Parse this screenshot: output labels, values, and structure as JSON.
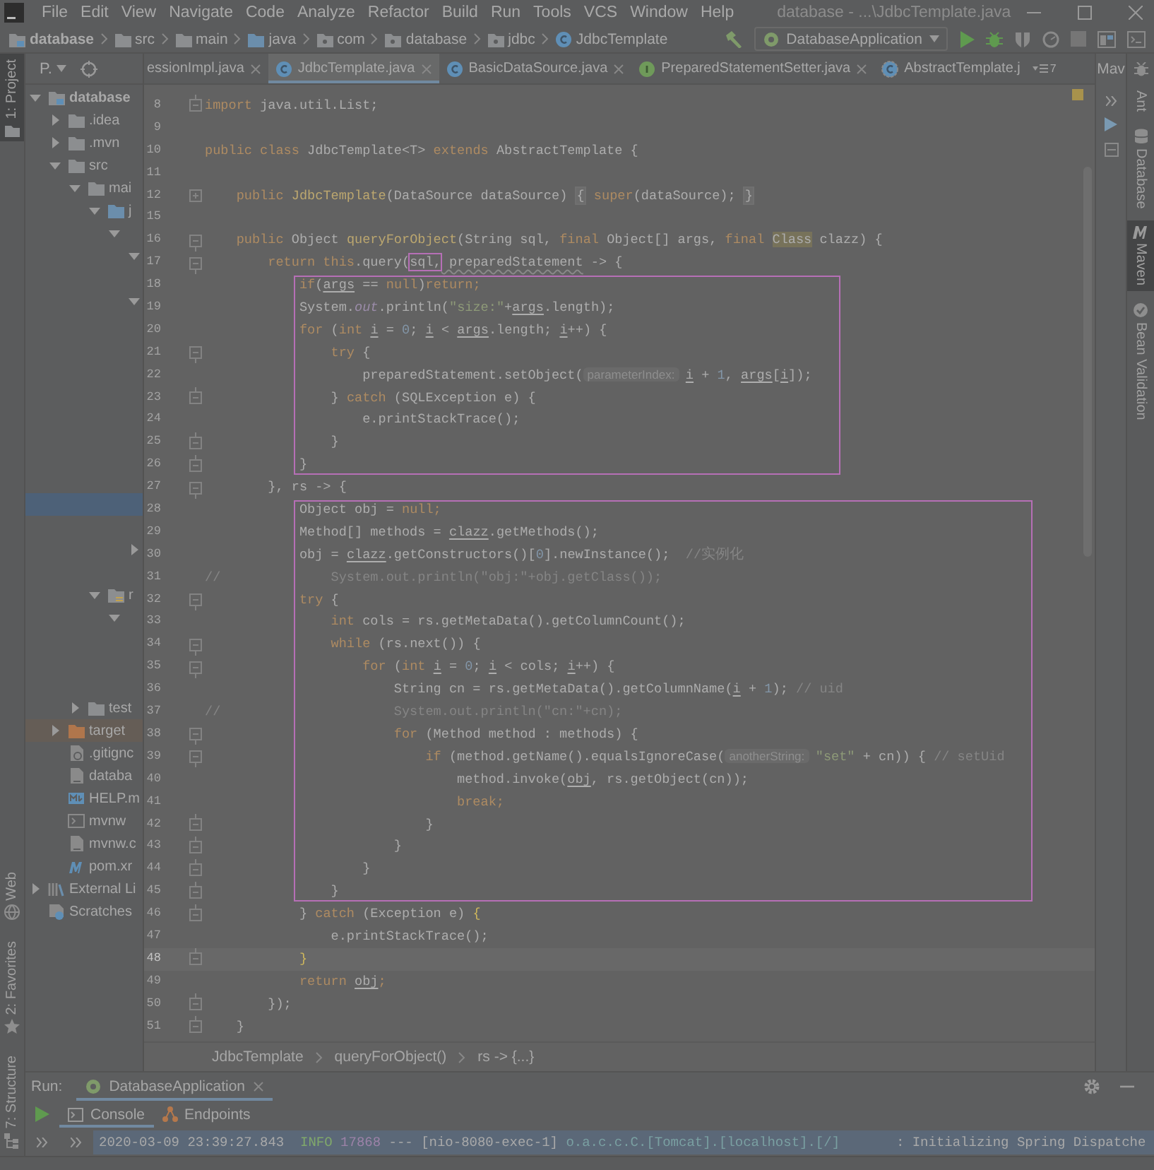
{
  "menu_bar": {
    "items": [
      "File",
      "Edit",
      "View",
      "Navigate",
      "Code",
      "Analyze",
      "Refactor",
      "Build",
      "Run",
      "Tools",
      "VCS",
      "Window",
      "Help"
    ],
    "title": "database - ...\\JdbcTemplate.java"
  },
  "navigation_bar": {
    "breadcrumbs": [
      {
        "label": "database",
        "kind": "module"
      },
      {
        "label": "src",
        "kind": "folder"
      },
      {
        "label": "main",
        "kind": "folder"
      },
      {
        "label": "java",
        "kind": "source"
      },
      {
        "label": "com",
        "kind": "package"
      },
      {
        "label": "database",
        "kind": "package"
      },
      {
        "label": "jdbc",
        "kind": "package"
      },
      {
        "label": "JdbcTemplate",
        "kind": "class"
      }
    ],
    "run_configuration": "DatabaseApplication"
  },
  "left_tool_strip": [
    {
      "label": "1: Project",
      "kind": "project",
      "selected": true
    },
    {
      "label": "Web",
      "kind": "web",
      "selected": false
    },
    {
      "label": "2: Favorites",
      "kind": "favorites",
      "selected": false
    },
    {
      "label": "7: Structure",
      "kind": "structure",
      "selected": false
    }
  ],
  "project_panel": {
    "view": "P.",
    "tree": [
      {
        "label": "database",
        "kind": "module",
        "expanded": true,
        "selected": false,
        "children": [
          {
            "label": ".idea",
            "kind": "folder",
            "expanded": false,
            "selected": false
          },
          {
            "label": ".mvn",
            "kind": "folder",
            "expanded": false,
            "selected": false
          },
          {
            "label": "src",
            "kind": "folder",
            "expanded": true,
            "selected": false,
            "children": [
              {
                "label": "mai",
                "kind": "folder",
                "expanded": true,
                "selected": false,
                "children": [
                  {
                    "label": "j",
                    "kind": "source",
                    "expanded": true,
                    "selected": false,
                    "children": [
                      {
                        "expanded": true,
                        "selected": false,
                        "children": [
                          {
                            "expanded": true,
                            "selected": false,
                            "children": [
                              {
                                "selected": false
                              }
                            ]
                          },
                          {
                            "expanded": true,
                            "selected": false,
                            "children": [
                              {
                                "selected": false
                              },
                              {
                                "selected": false
                              },
                              {
                                "selected": false
                              },
                              {
                                "selected": false
                              },
                              {
                                "selected": false
                              },
                              {
                                "selected": false
                              },
                              {
                                "selected": false
                              },
                              {
                                "selected": false
                              },
                              {
                                "selected": true
                              },
                              {
                                "selected": false
                              }
                            ]
                          },
                          {
                            "expanded": false,
                            "selected": false
                          },
                          {
                            "selected": false
                          }
                        ]
                      }
                    ]
                  },
                  {
                    "label": "r",
                    "kind": "resources",
                    "expanded": true,
                    "selected": false,
                    "children": [
                      {
                        "expanded": true,
                        "selected": false,
                        "children": [
                          {
                            "selected": false
                          },
                          {
                            "selected": false
                          },
                          {
                            "selected": false
                          }
                        ]
                      }
                    ]
                  }
                ]
              },
              {
                "label": "test",
                "kind": "folder",
                "expanded": false,
                "selected": false
              }
            ]
          },
          {
            "label": "target",
            "kind": "excluded",
            "expanded": false,
            "selected": false
          },
          {
            "label": ".gitignc",
            "kind": "ignore-file",
            "selected": false
          },
          {
            "label": "databa",
            "kind": "file",
            "selected": false
          },
          {
            "label": "HELP.m",
            "kind": "markdown",
            "selected": false
          },
          {
            "label": "mvnw",
            "kind": "script",
            "selected": false
          },
          {
            "label": "mvnw.c",
            "kind": "file",
            "selected": false
          },
          {
            "label": "pom.xr",
            "kind": "maven-pom",
            "selected": false
          }
        ]
      },
      {
        "label": "External Li",
        "kind": "library",
        "expanded": false,
        "selected": false
      },
      {
        "label": "Scratches",
        "kind": "scratch",
        "selected": false
      }
    ]
  },
  "editor": {
    "tabs": [
      {
        "label": "essionImpl.java",
        "kind": "hidden",
        "selected": false,
        "closable": true
      },
      {
        "label": "JdbcTemplate.java",
        "kind": "class",
        "selected": true,
        "closable": true
      },
      {
        "label": "BasicDataSource.java",
        "kind": "class",
        "selected": false,
        "closable": true
      },
      {
        "label": "PreparedStatementSetter.java",
        "kind": "interface",
        "selected": false,
        "closable": true
      },
      {
        "label": "AbstractTemplate.j",
        "kind": "abstract",
        "selected": false,
        "closable": false
      }
    ],
    "overflow_count": "7",
    "blocks": [
      {
        "boxed": false,
        "lines": [
          {
            "number": "8",
            "kind": "fold-end",
            "current": false,
            "tokens": [
              {
                "kind": "kw",
                "text": "import"
              },
              {
                "kind": "plain",
                "text": " java.util.List;"
              }
            ]
          },
          {
            "number": "9",
            "kind": "plain",
            "current": false
          },
          {
            "number": "10",
            "kind": "plain",
            "current": false,
            "tokens": [
              {
                "kind": "kw",
                "text": "public class "
              },
              {
                "kind": "plain",
                "text": "JdbcTemplate<T> "
              },
              {
                "kind": "kw",
                "text": "extends "
              },
              {
                "kind": "plain",
                "text": "AbstractTemplate {"
              }
            ]
          },
          {
            "number": "11",
            "kind": "plain",
            "current": false
          },
          {
            "number": "12",
            "kind": "folded",
            "current": false,
            "tokens": [
              {
                "kind": "kw",
                "text": "    public "
              },
              {
                "kind": "decl",
                "text": "JdbcTemplate"
              },
              {
                "kind": "plain",
                "text": "(DataSource dataSource) "
              },
              {
                "kind": "folded",
                "text": "{"
              },
              {
                "kind": "kw",
                "text": " super"
              },
              {
                "kind": "plain",
                "text": "(dataSource); "
              },
              {
                "kind": "folded",
                "text": "}"
              }
            ]
          },
          {
            "number": "15",
            "kind": "plain",
            "current": false
          },
          {
            "number": "16",
            "kind": "fold-start",
            "current": false,
            "tokens": [
              {
                "kind": "kw",
                "text": "    public "
              },
              {
                "kind": "plain",
                "text": "Object "
              },
              {
                "kind": "decl",
                "text": "queryForObject"
              },
              {
                "kind": "plain",
                "text": "(String sql, "
              },
              {
                "kind": "kw",
                "text": "final "
              },
              {
                "kind": "plain",
                "text": "Object[] args, "
              },
              {
                "kind": "kw",
                "text": "final "
              },
              {
                "kind": "highlight",
                "text": "Class"
              },
              {
                "kind": "plain",
                "text": " clazz) {"
              }
            ]
          },
          {
            "number": "17",
            "kind": "fold-start",
            "current": false,
            "tokens": [
              {
                "kind": "kw",
                "text": "        return this"
              },
              {
                "kind": "plain",
                "text": ".query("
              },
              {
                "kind": "boxed",
                "text": "sql,"
              },
              {
                "kind": "wavy",
                "text": " preparedStatement"
              },
              {
                "kind": "plain",
                "text": " -> {"
              }
            ]
          }
        ]
      },
      {
        "boxed": true,
        "lines": [
          {
            "number": "18",
            "kind": "plain",
            "current": false,
            "tokens": [
              {
                "kind": "kw",
                "text": "            if"
              },
              {
                "kind": "plain",
                "text": "("
              },
              {
                "kind": "captured",
                "text": "args"
              },
              {
                "kind": "plain",
                "text": " == "
              },
              {
                "kind": "kw",
                "text": "null"
              },
              {
                "kind": "plain",
                "text": ")"
              },
              {
                "kind": "kw",
                "text": "return;"
              }
            ]
          },
          {
            "number": "19",
            "kind": "plain",
            "current": false,
            "tokens": [
              {
                "kind": "plain",
                "text": "            System."
              },
              {
                "kind": "static",
                "text": "out"
              },
              {
                "kind": "plain",
                "text": ".println("
              },
              {
                "kind": "str",
                "text": "\"size:\""
              },
              {
                "kind": "plain",
                "text": "+"
              },
              {
                "kind": "captured",
                "text": "args"
              },
              {
                "kind": "plain",
                "text": ".length);"
              }
            ]
          },
          {
            "number": "20",
            "kind": "plain",
            "current": false,
            "tokens": [
              {
                "kind": "kw",
                "text": "            for "
              },
              {
                "kind": "plain",
                "text": "("
              },
              {
                "kind": "kw",
                "text": "int "
              },
              {
                "kind": "captured",
                "text": "i"
              },
              {
                "kind": "plain",
                "text": " = "
              },
              {
                "kind": "num",
                "text": "0"
              },
              {
                "kind": "plain",
                "text": "; "
              },
              {
                "kind": "captured",
                "text": "i"
              },
              {
                "kind": "plain",
                "text": " < "
              },
              {
                "kind": "captured",
                "text": "args"
              },
              {
                "kind": "plain",
                "text": ".length; "
              },
              {
                "kind": "captured",
                "text": "i"
              },
              {
                "kind": "plain",
                "text": "++) {"
              }
            ]
          },
          {
            "number": "21",
            "kind": "fold-start",
            "current": false,
            "tokens": [
              {
                "kind": "kw",
                "text": "                try "
              },
              {
                "kind": "plain",
                "text": "{"
              }
            ]
          },
          {
            "number": "22",
            "kind": "plain",
            "current": false,
            "tokens": [
              {
                "kind": "plain",
                "text": "                    preparedStatement.setObject("
              },
              {
                "kind": "hint",
                "text": "parameterIndex:"
              },
              {
                "kind": "captured",
                "text": "i"
              },
              {
                "kind": "plain",
                "text": " + "
              },
              {
                "kind": "num",
                "text": "1"
              },
              {
                "kind": "plain",
                "text": ", "
              },
              {
                "kind": "captured",
                "text": "args"
              },
              {
                "kind": "plain",
                "text": "["
              },
              {
                "kind": "captured",
                "text": "i"
              },
              {
                "kind": "plain",
                "text": "]);"
              }
            ]
          },
          {
            "number": "23",
            "kind": "fold-end",
            "current": false,
            "tokens": [
              {
                "kind": "plain",
                "text": "                } "
              },
              {
                "kind": "kw",
                "text": "catch "
              },
              {
                "kind": "plain",
                "text": "(SQLException e) {"
              }
            ]
          },
          {
            "number": "24",
            "kind": "plain",
            "current": false,
            "tokens": [
              {
                "kind": "plain",
                "text": "                    e.printStackTrace();"
              }
            ]
          },
          {
            "number": "25",
            "kind": "fold-end",
            "current": false,
            "tokens": [
              {
                "kind": "plain",
                "text": "                }"
              }
            ]
          },
          {
            "number": "26",
            "kind": "fold-end",
            "current": false,
            "tokens": [
              {
                "kind": "plain",
                "text": "            }"
              }
            ]
          }
        ]
      },
      {
        "boxed": false,
        "lines": [
          {
            "number": "27",
            "kind": "fold-start",
            "current": false,
            "tokens": [
              {
                "kind": "plain",
                "text": "        }, rs -> {"
              }
            ]
          }
        ]
      },
      {
        "boxed": true,
        "lines": [
          {
            "number": "28",
            "kind": "plain",
            "current": false,
            "tokens": [
              {
                "kind": "plain",
                "text": "            Object obj = "
              },
              {
                "kind": "kw",
                "text": "null;"
              }
            ]
          },
          {
            "number": "29",
            "kind": "plain",
            "current": false,
            "tokens": [
              {
                "kind": "plain",
                "text": "            Method[] methods = "
              },
              {
                "kind": "captured",
                "text": "clazz"
              },
              {
                "kind": "plain",
                "text": ".getMethods();"
              }
            ]
          },
          {
            "number": "30",
            "kind": "plain",
            "current": false,
            "tokens": [
              {
                "kind": "plain",
                "text": "            obj = "
              },
              {
                "kind": "captured",
                "text": "clazz"
              },
              {
                "kind": "plain",
                "text": ".getConstructors()["
              },
              {
                "kind": "num",
                "text": "0"
              },
              {
                "kind": "plain",
                "text": "].newInstance();  "
              },
              {
                "kind": "comment",
                "text": "//实例化"
              }
            ]
          },
          {
            "number": "31",
            "kind": "plain",
            "current": false,
            "tokens": [
              {
                "kind": "comment",
                "text": "//              System.out.println(\"obj:\"+obj.getClass());"
              }
            ]
          },
          {
            "number": "32",
            "kind": "fold-start",
            "current": false,
            "tokens": [
              {
                "kind": "kw",
                "text": "            try "
              },
              {
                "kind": "plain",
                "text": "{"
              }
            ]
          },
          {
            "number": "33",
            "kind": "plain",
            "current": false,
            "tokens": [
              {
                "kind": "kw",
                "text": "                int "
              },
              {
                "kind": "plain",
                "text": "cols = rs.getMetaData().getColumnCount();"
              }
            ]
          },
          {
            "number": "34",
            "kind": "fold-start",
            "current": false,
            "tokens": [
              {
                "kind": "kw",
                "text": "                while "
              },
              {
                "kind": "plain",
                "text": "(rs.next()) {"
              }
            ]
          },
          {
            "number": "35",
            "kind": "fold-start",
            "current": false,
            "tokens": [
              {
                "kind": "kw",
                "text": "                    for "
              },
              {
                "kind": "plain",
                "text": "("
              },
              {
                "kind": "kw",
                "text": "int "
              },
              {
                "kind": "captured",
                "text": "i"
              },
              {
                "kind": "plain",
                "text": " = "
              },
              {
                "kind": "num",
                "text": "0"
              },
              {
                "kind": "plain",
                "text": "; "
              },
              {
                "kind": "captured",
                "text": "i"
              },
              {
                "kind": "plain",
                "text": " < cols; "
              },
              {
                "kind": "captured",
                "text": "i"
              },
              {
                "kind": "plain",
                "text": "++) {"
              }
            ]
          },
          {
            "number": "36",
            "kind": "plain",
            "current": false,
            "tokens": [
              {
                "kind": "plain",
                "text": "                        String cn = rs.getMetaData().getColumnName("
              },
              {
                "kind": "captured",
                "text": "i"
              },
              {
                "kind": "plain",
                "text": " + "
              },
              {
                "kind": "num",
                "text": "1"
              },
              {
                "kind": "plain",
                "text": "); "
              },
              {
                "kind": "comment",
                "text": "// uid"
              }
            ]
          },
          {
            "number": "37",
            "kind": "plain",
            "current": false,
            "tokens": [
              {
                "kind": "comment",
                "text": "//                      System.out.println(\"cn:\"+cn);"
              }
            ]
          },
          {
            "number": "38",
            "kind": "fold-start",
            "current": false,
            "tokens": [
              {
                "kind": "kw",
                "text": "                        for "
              },
              {
                "kind": "plain",
                "text": "(Method method : methods) {"
              }
            ]
          },
          {
            "number": "39",
            "kind": "fold-start",
            "current": false,
            "tokens": [
              {
                "kind": "kw",
                "text": "                            if "
              },
              {
                "kind": "plain",
                "text": "(method.getName().equalsIgnoreCase("
              },
              {
                "kind": "hint",
                "text": "anotherString:"
              },
              {
                "kind": "str",
                "text": "\"set\""
              },
              {
                "kind": "plain",
                "text": " + cn)) { "
              },
              {
                "kind": "comment",
                "text": "// setUid"
              }
            ]
          },
          {
            "number": "40",
            "kind": "plain",
            "current": false,
            "tokens": [
              {
                "kind": "plain",
                "text": "                                method.invoke("
              },
              {
                "kind": "captured",
                "text": "obj"
              },
              {
                "kind": "plain",
                "text": ", rs.getObject(cn));"
              }
            ]
          },
          {
            "number": "41",
            "kind": "plain",
            "current": false,
            "tokens": [
              {
                "kind": "kw",
                "text": "                                break;"
              }
            ]
          },
          {
            "number": "42",
            "kind": "fold-end",
            "current": false,
            "tokens": [
              {
                "kind": "plain",
                "text": "                            }"
              }
            ]
          },
          {
            "number": "43",
            "kind": "fold-end",
            "current": false,
            "tokens": [
              {
                "kind": "plain",
                "text": "                        }"
              }
            ]
          },
          {
            "number": "44",
            "kind": "fold-end",
            "current": false,
            "tokens": [
              {
                "kind": "plain",
                "text": "                    }"
              }
            ]
          },
          {
            "number": "45",
            "kind": "fold-end",
            "current": false,
            "tokens": [
              {
                "kind": "plain",
                "text": "                }"
              }
            ]
          }
        ]
      },
      {
        "boxed": false,
        "lines": [
          {
            "number": "46",
            "kind": "fold-end",
            "current": false,
            "tokens": [
              {
                "kind": "plain",
                "text": "            } "
              },
              {
                "kind": "kw",
                "text": "catch "
              },
              {
                "kind": "plain",
                "text": "(Exception e) "
              },
              {
                "kind": "match",
                "text": "{"
              }
            ]
          },
          {
            "number": "47",
            "kind": "plain",
            "current": false,
            "tokens": [
              {
                "kind": "plain",
                "text": "                e.printStackTrace();"
              }
            ]
          },
          {
            "number": "48",
            "kind": "fold-end",
            "current": true,
            "tokens": [
              {
                "kind": "match",
                "text": "            }"
              }
            ]
          },
          {
            "number": "49",
            "kind": "plain",
            "current": false,
            "tokens": [
              {
                "kind": "kw",
                "text": "            return "
              },
              {
                "kind": "captured",
                "text": "obj"
              },
              {
                "kind": "kw",
                "text": ";"
              }
            ]
          },
          {
            "number": "50",
            "kind": "fold-end",
            "current": false,
            "tokens": [
              {
                "kind": "plain",
                "text": "        });"
              }
            ]
          },
          {
            "number": "51",
            "kind": "fold-end",
            "current": false,
            "tokens": [
              {
                "kind": "plain",
                "text": "    }"
              }
            ]
          }
        ]
      }
    ],
    "breadcrumbs": [
      "JdbcTemplate",
      "queryForObject()",
      "rs -> {...}"
    ]
  },
  "maven_panel": {
    "header": "Mav"
  },
  "right_tool_strip": [
    {
      "label": "Ant",
      "kind": "ant",
      "selected": false
    },
    {
      "label": "Database",
      "kind": "database",
      "selected": false
    },
    {
      "label": "Maven",
      "kind": "maven",
      "selected": true
    },
    {
      "label": "Bean Validation",
      "kind": "bean",
      "selected": false
    }
  ],
  "run_panel": {
    "title": "Run:",
    "tab": {
      "label": "DatabaseApplication",
      "selected": true
    },
    "subtabs": [
      {
        "label": "Console",
        "kind": "console",
        "selected": true
      },
      {
        "label": "Endpoints",
        "kind": "endpoints",
        "selected": false
      }
    ],
    "log": [
      {
        "selected": true,
        "tokens": [
          {
            "kind": "plain",
            "text": "2020-03-09 23:39:27.843  "
          },
          {
            "kind": "info",
            "text": "INFO"
          },
          {
            "kind": "pid",
            "text": " 17868"
          },
          {
            "kind": "plain",
            "text": " --- [nio-8080-exec-1] "
          },
          {
            "kind": "logger",
            "text": "o.a.c.c.C.[Tomcat].[localhost].[/]"
          },
          {
            "kind": "plain",
            "text": "       : Initializing Spring Dispatche"
          }
        ]
      }
    ]
  }
}
